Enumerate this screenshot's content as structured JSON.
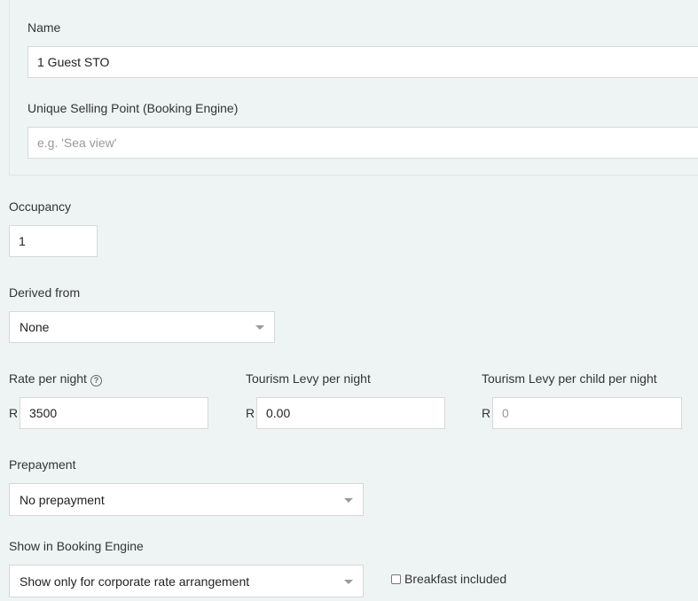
{
  "name_section": {
    "name_label": "Name",
    "name_value": "1 Guest STO",
    "usp_label": "Unique Selling Point (Booking Engine)",
    "usp_placeholder": "e.g. 'Sea view'"
  },
  "occupancy": {
    "label": "Occupancy",
    "value": "1"
  },
  "derived_from": {
    "label": "Derived from",
    "selected": "None"
  },
  "rates": {
    "currency_prefix": "R",
    "rate_per_night_label": "Rate per night",
    "rate_per_night_value": "3500",
    "tourism_levy_label": "Tourism Levy per night",
    "tourism_levy_value": "0.00",
    "tourism_levy_child_label": "Tourism Levy per child per night",
    "tourism_levy_child_placeholder": "0",
    "help_icon_glyph": "?"
  },
  "prepayment": {
    "label": "Prepayment",
    "selected": "No prepayment"
  },
  "booking_engine": {
    "label": "Show in Booking Engine",
    "selected": "Show only for corporate rate arrangement"
  },
  "breakfast": {
    "label": "Breakfast included",
    "checked": false
  }
}
